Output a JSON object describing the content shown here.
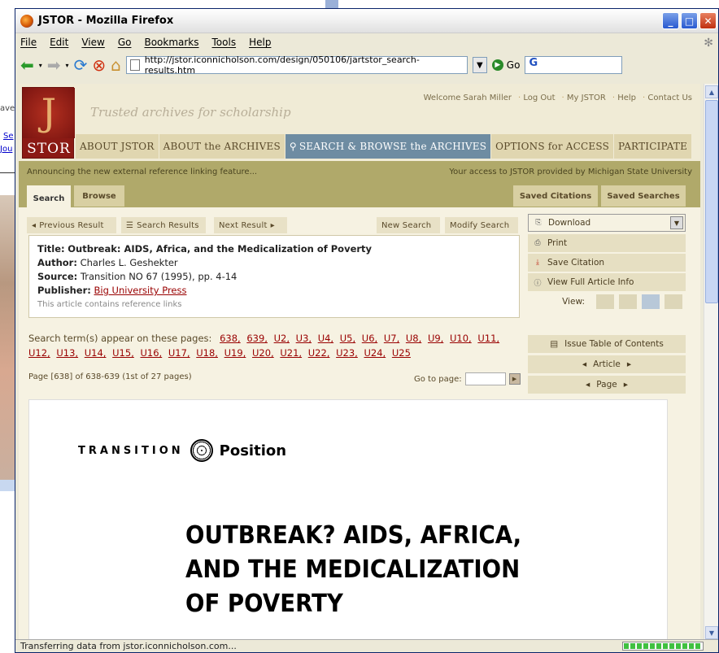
{
  "background": {
    "partial_text_1": "ave",
    "partial_link_1": "Se",
    "partial_link_2": "Jou"
  },
  "window": {
    "title": "JSTOR - Mozilla Firefox",
    "minimize": "_",
    "maximize": "□",
    "close": "✕"
  },
  "menu": [
    "File",
    "Edit",
    "View",
    "Go",
    "Bookmarks",
    "Tools",
    "Help"
  ],
  "toolbar": {
    "url": "http://jstor.iconnicholson.com/design/050106/jartstor_search-results.htm",
    "go_label": "Go",
    "search_engine": "G"
  },
  "jstor": {
    "logo_letter": "J",
    "logo_text": "STOR",
    "tagline": "Trusted archives for scholarship",
    "top_links": [
      "Welcome Sarah Miller",
      "Log Out",
      "My JSTOR",
      "Help",
      "Contact Us"
    ],
    "nav": [
      {
        "label": "ABOUT JSTOR"
      },
      {
        "label": "ABOUT the ARCHIVES"
      },
      {
        "label": "SEARCH & BROWSE the ARCHIVES",
        "active": true
      },
      {
        "label": "OPTIONS for ACCESS"
      },
      {
        "label": "PARTICIPATE"
      }
    ],
    "announcement": "Announcing the new external reference linking feature...",
    "access": "Your access to JSTOR provided by Michigan State University",
    "tabs_left": [
      "Search",
      "Browse"
    ],
    "tabs_right": [
      "Saved Citations",
      "Saved Searches"
    ],
    "result_nav": {
      "previous": "Previous Result",
      "search_results": "Search Results",
      "next": "Next Result",
      "new_search": "New Search",
      "modify_search": "Modify Search"
    },
    "citation": {
      "title_label": "Title:",
      "title": "Outbreak: AIDS, Africa, and the Medicalization of Poverty",
      "author_label": "Author:",
      "author": "Charles L. Geshekter",
      "source_label": "Source:",
      "source": "Transition NO 67 (1995), pp. 4-14",
      "publisher_label": "Publisher:",
      "publisher": "Big University Press",
      "note": "This article contains reference links"
    },
    "sidebar": {
      "download": "Download",
      "print": "Print",
      "save_citation": "Save Citation",
      "view_full": "View Full Article Info",
      "view_label": "View:",
      "issue_toc": "Issue Table of Contents",
      "article": "Article",
      "page": "Page"
    },
    "search_terms_label": "Search term(s) appear on these pages:",
    "search_pages": [
      "638,",
      "639,",
      "U2,",
      "U3,",
      "U4,",
      "U5,",
      "U6,",
      "U7,",
      "U8,",
      "U9,",
      "U10,",
      "U11,",
      "U12,",
      "U13,",
      "U14,",
      "U15,",
      "U16,",
      "U17,",
      "U18,",
      "U19,",
      "U20,",
      "U21,",
      "U22,",
      "U23,",
      "U24,",
      "U25"
    ],
    "page_info": "Page [638] of 638-639  (1st of 27 pages)",
    "goto_label": "Go to page:",
    "doc": {
      "journal": "TRANSITION",
      "section": "Position",
      "title_lines": [
        "OUTBREAK? AIDS, AFRICA,",
        "AND THE MEDICALIZATION",
        "OF POVERTY"
      ]
    }
  },
  "status": "Transferring data from jstor.iconnicholson.com...",
  "progress": 1.0
}
